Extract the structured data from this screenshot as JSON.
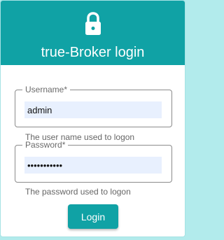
{
  "header": {
    "title": "true-Broker login",
    "icon": "lock-icon",
    "background_color": "#10a2a5"
  },
  "form": {
    "username": {
      "label": "Username*",
      "value": "admin",
      "helper_text": "The user name used to logon"
    },
    "password": {
      "label": "Password*",
      "value": "•••••••••••",
      "helper_text": "The password used to logon"
    },
    "login_label": "Login"
  },
  "colors": {
    "accent": "#10a2a5",
    "input_fill": "#e8f0fe"
  }
}
